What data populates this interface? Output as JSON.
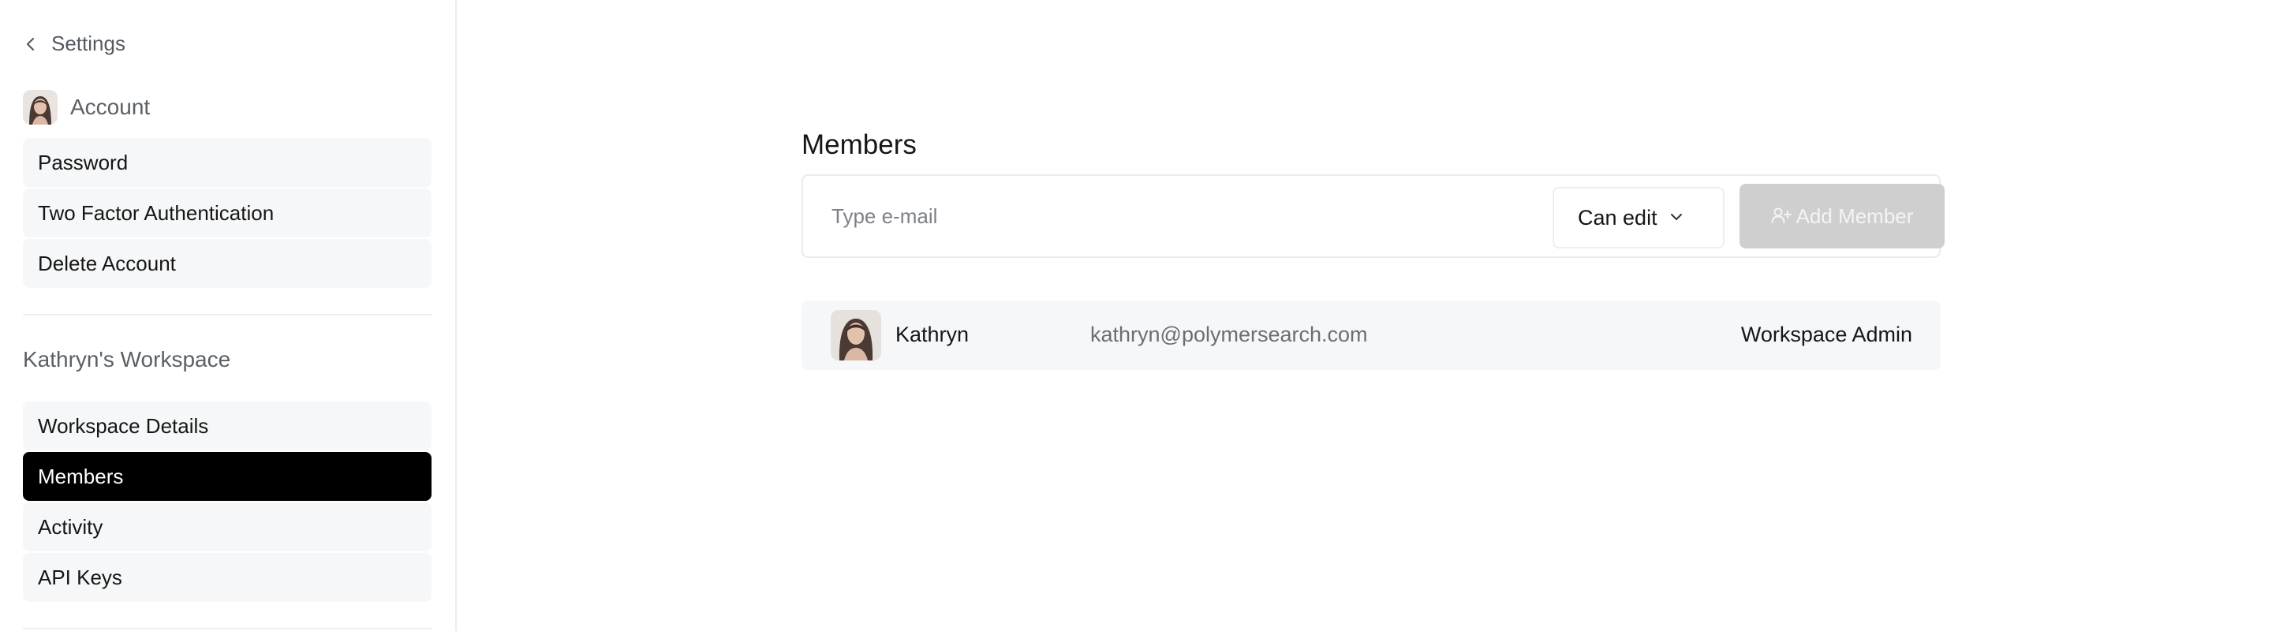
{
  "sidebar": {
    "back_label": "Settings",
    "account_label": "Account",
    "account_items": [
      {
        "label": "Password"
      },
      {
        "label": "Two Factor Authentication"
      },
      {
        "label": "Delete Account"
      }
    ],
    "workspace_label": "Kathryn's Workspace",
    "workspace_items": [
      {
        "label": "Workspace Details"
      },
      {
        "label": "Members"
      },
      {
        "label": "Activity"
      },
      {
        "label": "API Keys"
      }
    ],
    "active_item": "Members"
  },
  "main": {
    "title": "Members",
    "invite": {
      "email_placeholder": "Type e-mail",
      "permission_value": "Can edit",
      "add_button_label": "Add Member",
      "add_button_enabled": false
    },
    "members": [
      {
        "name": "Kathryn",
        "email": "kathryn@polymersearch.com",
        "role": "Workspace Admin"
      }
    ]
  },
  "icons": {
    "back": "chevron-left-icon",
    "dropdown": "chevron-down-icon",
    "add_member": "user-plus-icon"
  },
  "colors": {
    "active_bg": "#000000",
    "item_bg": "#f6f7f8",
    "button_disabled": "#cfcfcf"
  }
}
